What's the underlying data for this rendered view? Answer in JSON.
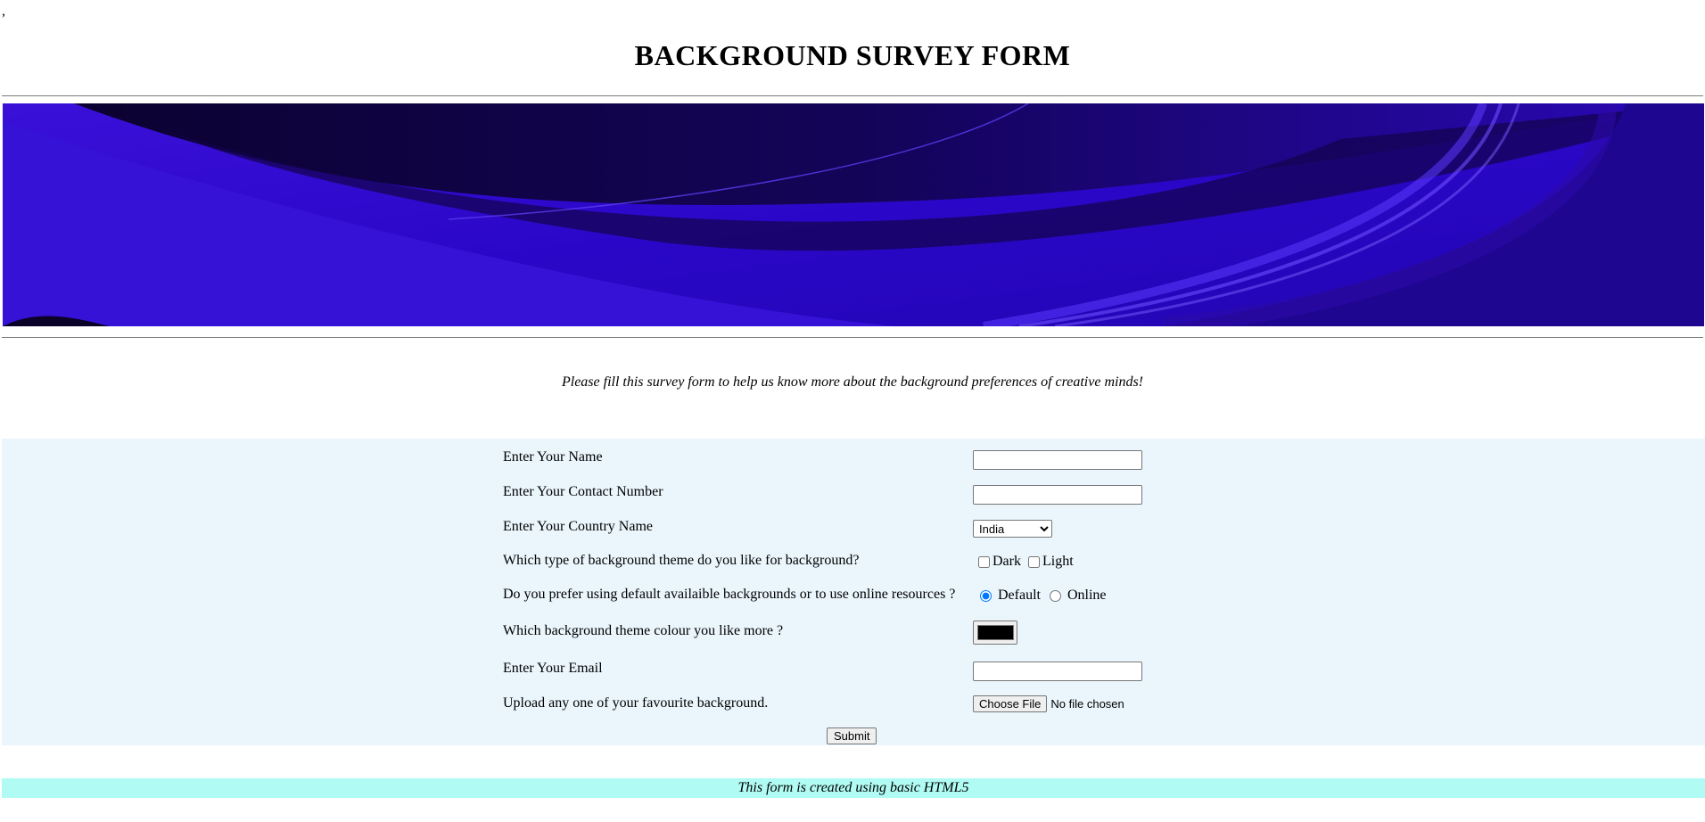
{
  "page": {
    "stray_char": ",",
    "title": "BACKGROUND SURVEY FORM"
  },
  "intro": "Please fill this survey form to help us know more about the background preferences of creative minds!",
  "colors": {
    "banner_base": "#2a07c8",
    "form_bg": "#eaf6fc",
    "footer_bg": "#b0fbf3",
    "chosen_color": "#000000"
  },
  "form": {
    "name_label": "Enter Your Name",
    "name_value": "",
    "contact_label": "Enter Your Contact Number",
    "contact_value": "",
    "country_label": "Enter Your Country Name",
    "country_selected": "India",
    "theme_label": "Which type of background theme do you like for background?",
    "theme_options": [
      "Dark",
      "Light"
    ],
    "source_label": "Do you prefer using default availaible backgrounds or to use online resources ?",
    "source_options": [
      "Default",
      "Online"
    ],
    "source_selected": "Default",
    "colour_label": "Which background theme colour you like more ?",
    "email_label": "Enter Your Email",
    "email_value": "",
    "upload_label": "Upload any one of your favourite background.",
    "upload_button": "Choose File",
    "upload_status": "No file chosen",
    "submit_label": "Submit"
  },
  "footer": "This form is created using basic HTML5"
}
